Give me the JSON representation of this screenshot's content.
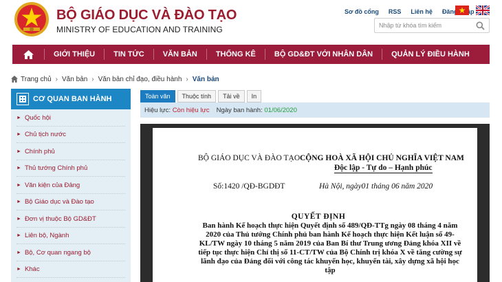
{
  "header": {
    "title_vi": "BỘ GIÁO DỤC VÀ ĐÀO TẠO",
    "title_en": "MINISTRY OF EDUCATION AND TRAINING",
    "links": [
      "Sơ đồ cổng",
      "RSS",
      "Liên hệ",
      "Đăng nhập"
    ],
    "search_placeholder": "Nhập từ khóa tìm kiếm"
  },
  "nav": {
    "items": [
      "GIỚI THIỆU",
      "TIN TỨC",
      "VĂN BẢN",
      "THỐNG KÊ",
      "BỘ GD&ĐT VỚI NHÂN DÂN",
      "QUẢN LÝ ĐIỀU HÀNH"
    ]
  },
  "breadcrumb": [
    "Trang chủ",
    "Văn bản",
    "Văn bản chỉ đạo, điều hành",
    "Văn bản"
  ],
  "sidebar": {
    "title": "CƠ QUAN BAN HÀNH",
    "items": [
      "Quốc hội",
      "Chủ tịch nước",
      "Chính phủ",
      "Thủ tướng Chính phủ",
      "Văn kiện của Đảng",
      "Bộ Giáo dục và Đào tạo",
      "Đơn vị thuộc Bộ GD&ĐT",
      "Liên bộ, Ngành",
      "Bộ, Cơ quan ngang bộ",
      "Khác"
    ]
  },
  "tabs": [
    "Toàn văn",
    "Thuộc tính",
    "Tải về",
    "In"
  ],
  "status": {
    "effect_label": "Hiệu lực:",
    "effect_value": "Còn hiệu lực",
    "date_label": "Ngày ban hành:",
    "date_value": "01/06/2020"
  },
  "document": {
    "org": "BỘ GIÁO DỤC VÀ ĐÀO TẠO",
    "nation": "CỘNG HOÀ XÃ HỘI CHỦ NGHĨA VIỆT NAM",
    "motto": "Độc lập - Tự do – Hạnh phúc",
    "number": "Số:1420 /QĐ-BGDĐT",
    "date": "Hà Nội, ngày01  tháng 06  năm 2020",
    "type": "QUYẾT  ĐỊNH",
    "abstract": "Ban hành Kế hoạch thực hiện Quyết định số 489/QĐ-TTg ngày 08 tháng 4 năm 2020 của Thủ tướng Chính phủ ban hành Kế hoạch thực hiện Kết luận số 49-KL/TW ngày 10 tháng 5 năm 2019 của Ban Bí thư Trung ương Đảng khóa XII về tiếp tục thực hiện Chỉ thị số 11-CT/TW của Bộ Chính trị khóa X về tăng cường sự lãnh đạo của Đảng đối với công tác khuyến học, khuyến tài, xây dựng xã hội học tập"
  },
  "colors": {
    "brand_red": "#9b1c3b",
    "sidebar_blue": "#1d86c4",
    "status_red": "#c0232f",
    "status_green": "#239b3a"
  },
  "icons": [
    "national-emblem-icon",
    "vietnam-flag-icon",
    "uk-flag-icon",
    "search-icon",
    "home-icon",
    "building-icon"
  ]
}
